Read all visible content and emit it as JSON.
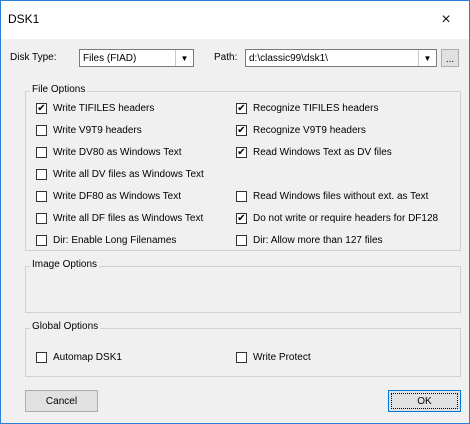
{
  "window": {
    "title": "DSK1"
  },
  "top": {
    "disk_type_label": "Disk Type:",
    "disk_type_value": "Files (FIAD)",
    "path_label": "Path:",
    "path_value": "d:\\classic99\\dsk1\\",
    "browse_label": "..."
  },
  "file_options": {
    "title": "File Options",
    "left": [
      {
        "label": "Write TIFILES headers",
        "checked": true
      },
      {
        "label": "Write V9T9 headers",
        "checked": false
      },
      {
        "label": "Write DV80 as Windows Text",
        "checked": false
      },
      {
        "label": "Write all DV files as Windows Text",
        "checked": false
      },
      {
        "label": "Write DF80 as Windows Text",
        "checked": false
      },
      {
        "label": "Write all DF files as Windows Text",
        "checked": false
      },
      {
        "label": "Dir: Enable Long Filenames",
        "checked": false
      }
    ],
    "right": [
      {
        "label": "Recognize TIFILES headers",
        "checked": true
      },
      {
        "label": "Recognize V9T9 headers",
        "checked": true
      },
      {
        "label": "Read Windows Text as DV files",
        "checked": true
      },
      {
        "label": "Read Windows files without ext. as Text",
        "checked": false
      },
      {
        "label": "Do not write or require headers for DF128",
        "checked": true
      },
      {
        "label": "Dir: Allow more than 127 files",
        "checked": false
      }
    ]
  },
  "image_options": {
    "title": "Image Options"
  },
  "global_options": {
    "title": "Global Options",
    "automap": {
      "label": "Automap DSK1",
      "checked": false
    },
    "write_protect": {
      "label": "Write Protect",
      "checked": false
    }
  },
  "buttons": {
    "cancel": "Cancel",
    "ok": "OK"
  },
  "icons": {
    "close": "×",
    "dropdown": "▼",
    "check": "✔"
  }
}
